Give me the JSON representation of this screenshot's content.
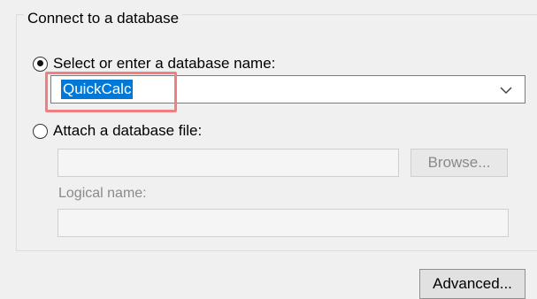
{
  "group": {
    "title": "Connect to a database"
  },
  "option_select": {
    "label": "Select or enter a database name:",
    "checked": true
  },
  "database_combo": {
    "value": "QuickCalc"
  },
  "option_attach": {
    "label": "Attach a database file:",
    "checked": false
  },
  "file_path": {
    "value": ""
  },
  "browse_button": {
    "label": "Browse..."
  },
  "logical_name": {
    "label": "Logical name:",
    "value": ""
  },
  "advanced_button": {
    "label": "Advanced..."
  },
  "colors": {
    "selection": "#0078d7",
    "annotation": "#f08080"
  }
}
